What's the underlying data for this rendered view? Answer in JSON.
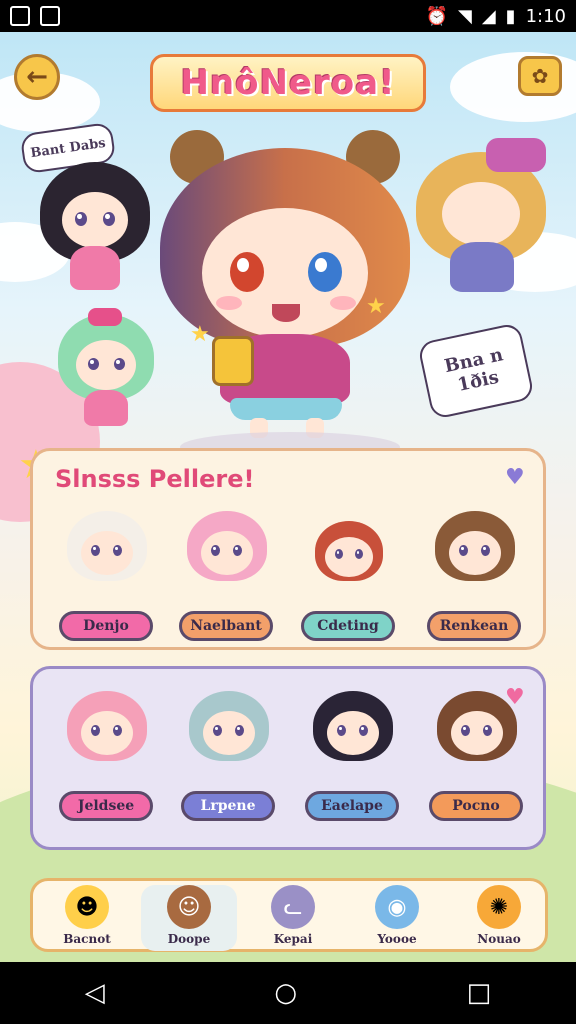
{
  "status_bar": {
    "time": "1:10"
  },
  "game": {
    "title": "HnôNeroa!",
    "left_bubble": "Bant Dabs",
    "right_sign_line1": "Bna n",
    "right_sign_line2": "1ðis",
    "panel1": {
      "title": "Slnsss Pellere!",
      "cards": [
        {
          "name": "Denjo",
          "color": "#f26aa8"
        },
        {
          "name": "Naelbant",
          "color": "#f3a06a"
        },
        {
          "name": "Cdeting",
          "color": "#7fd3c8"
        },
        {
          "name": "Renkean",
          "color": "#f3a06a"
        }
      ]
    },
    "panel2": {
      "cards": [
        {
          "name": "Jeldsee",
          "color": "#f26aa8"
        },
        {
          "name": "Lrpene",
          "color": "#7b7fd6"
        },
        {
          "name": "Eaelape",
          "color": "#6ea8e0"
        },
        {
          "name": "Pocno",
          "color": "#f39a5a"
        }
      ]
    },
    "bottom_nav": [
      {
        "label": "Bacnot"
      },
      {
        "label": "Doope"
      },
      {
        "label": "Kepai"
      },
      {
        "label": "Yoooe"
      },
      {
        "label": "Nouao"
      }
    ]
  }
}
